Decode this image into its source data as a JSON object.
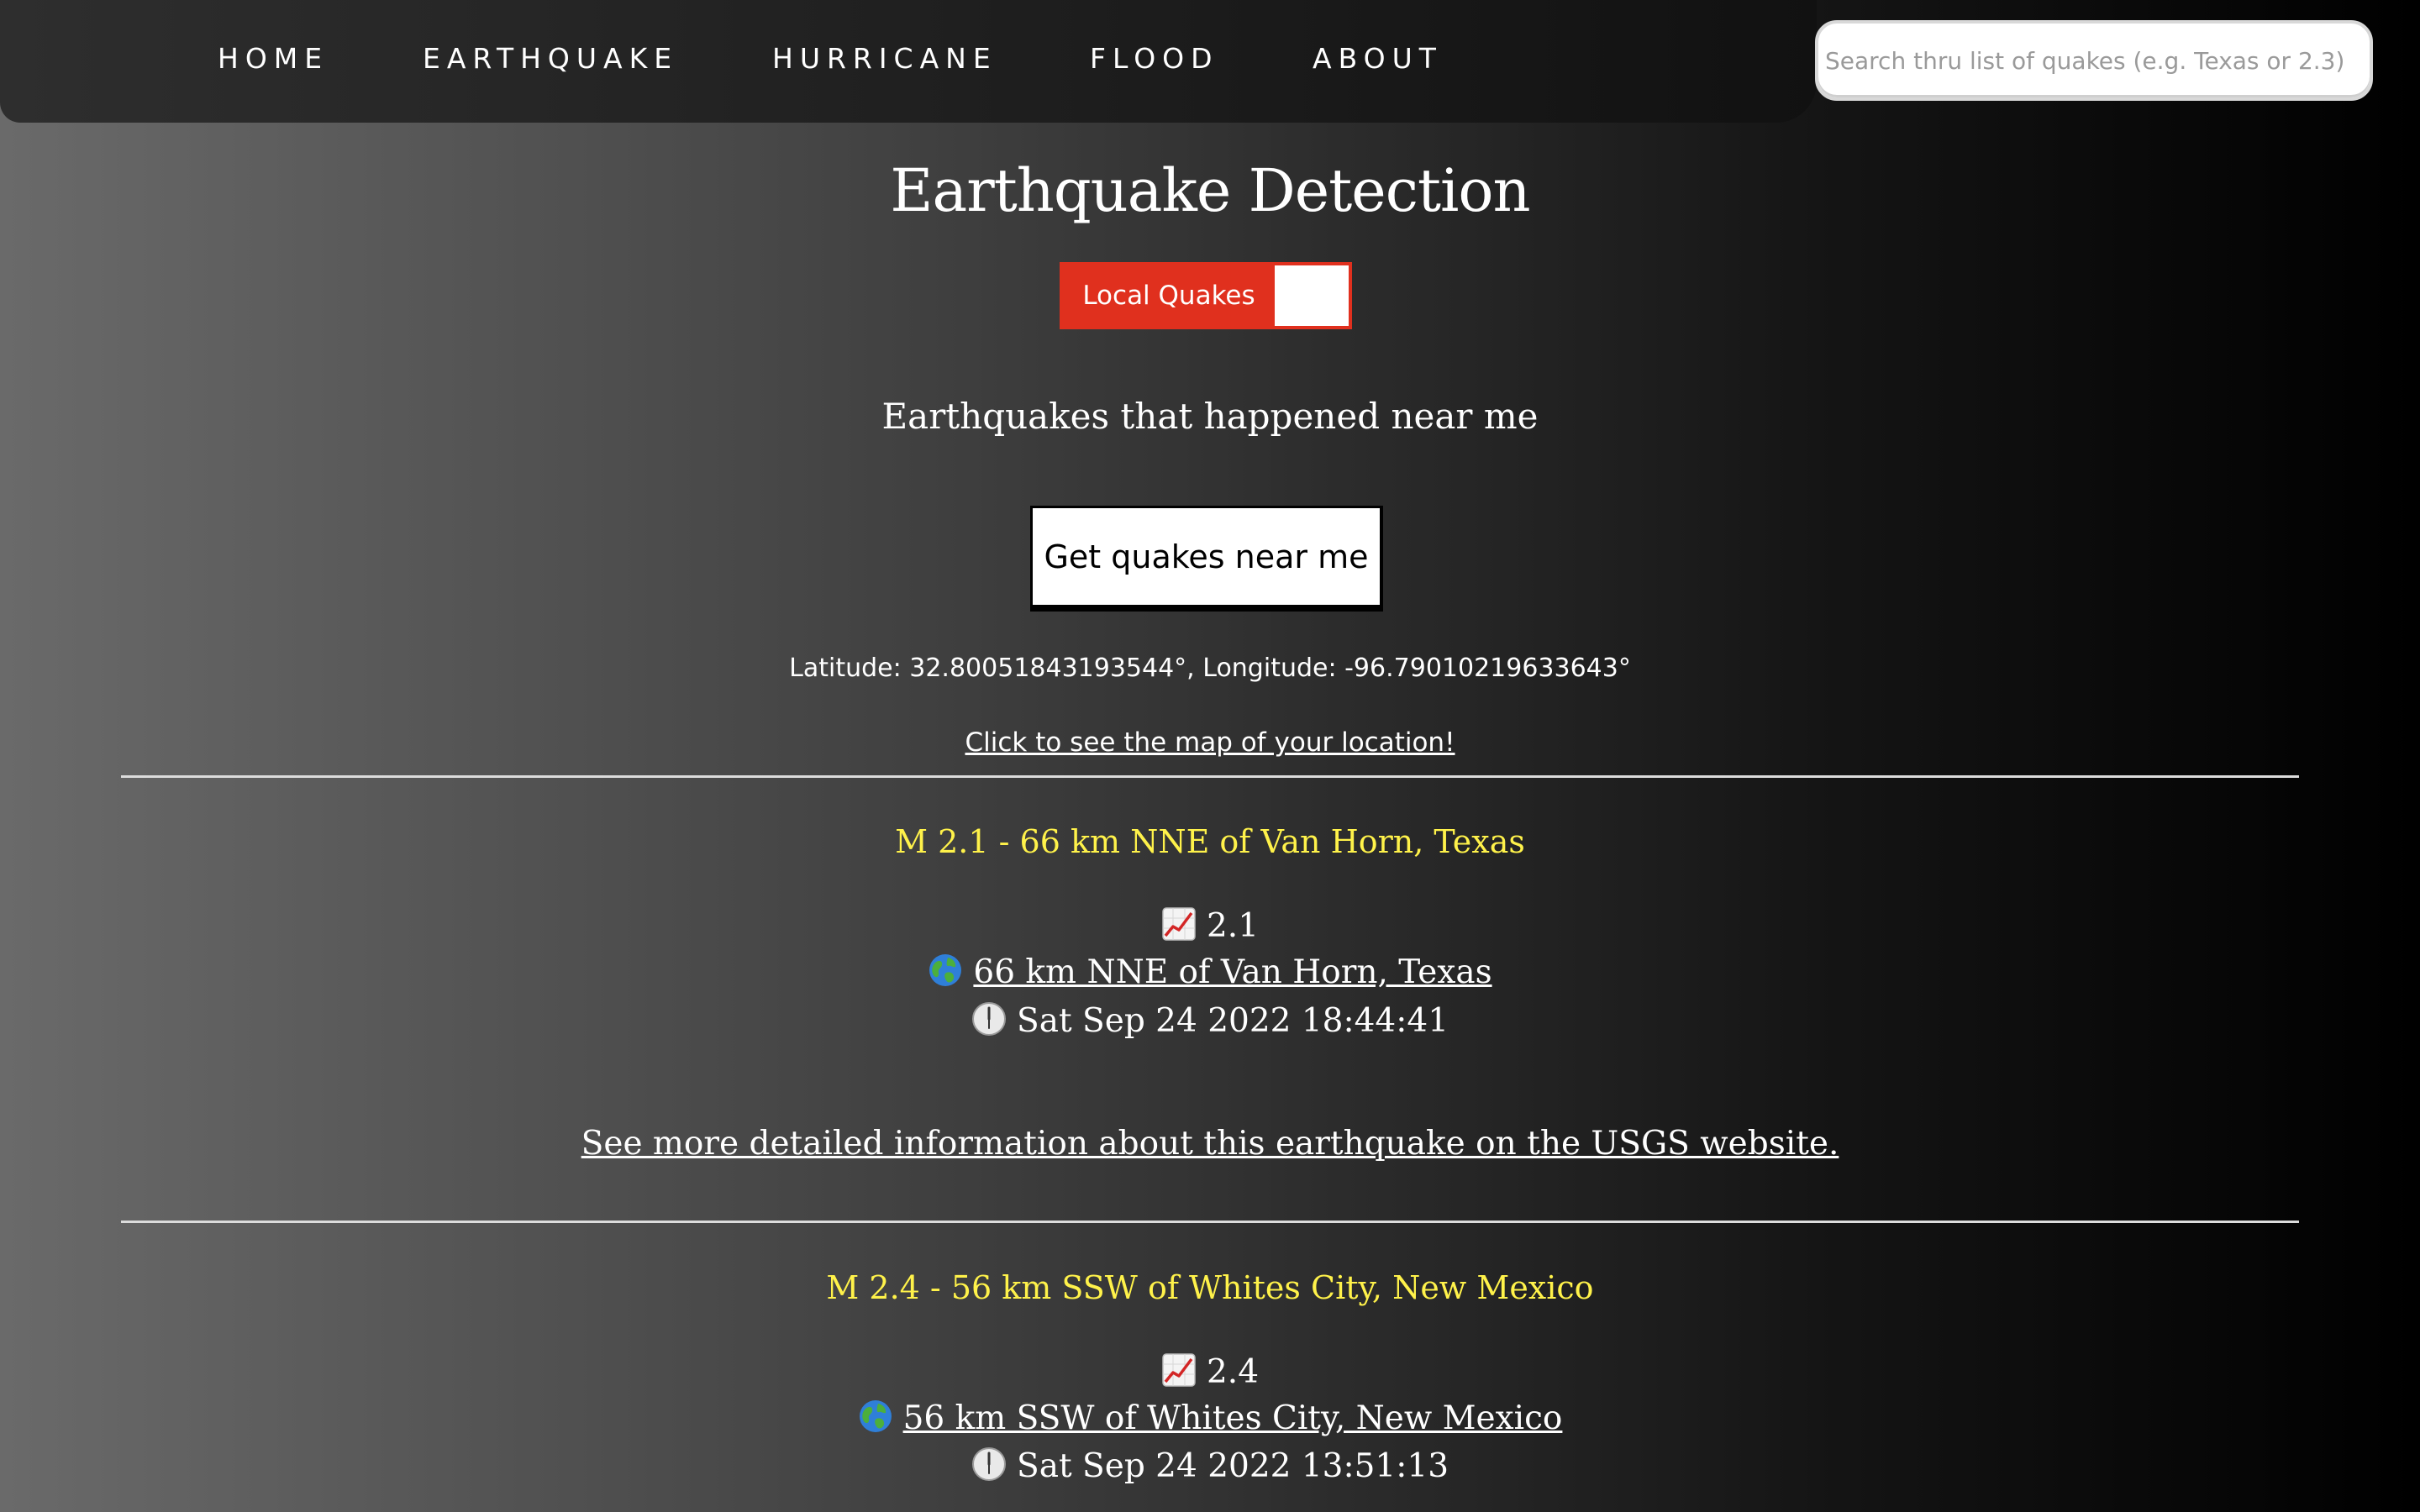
{
  "nav": {
    "items": [
      {
        "label": "HOME"
      },
      {
        "label": "EARTHQUAKE"
      },
      {
        "label": "HURRICANE"
      },
      {
        "label": "FLOOD"
      },
      {
        "label": "ABOUT"
      }
    ],
    "search_placeholder": "Search thru list of quakes (e.g. Texas or 2.3)"
  },
  "main": {
    "title": "Earthquake Detection",
    "toggle_label": "Local Quakes",
    "subtitle": "Earthquakes that happened near me",
    "get_button_label": "Get quakes near me",
    "coordinates": "Latitude: 32.80051843193544°, Longitude: -96.79010219633643°",
    "map_link": "Click to see the map of your location!"
  },
  "quakes": [
    {
      "title": "M 2.1 - 66 km NNE of Van Horn, Texas",
      "magnitude": "2.1",
      "place": "66 km NNE of Van Horn, Texas",
      "time": "Sat Sep 24 2022 18:44:41",
      "usgs_link": "See more detailed information about this earthquake on the USGS website."
    },
    {
      "title": "M 2.4 - 56 km SSW of Whites City, New Mexico",
      "magnitude": "2.4",
      "place": "56 km SSW of Whites City, New Mexico",
      "time": "Sat Sep 24 2022 13:51:13"
    }
  ],
  "icons": {
    "magnitude": "chart-increasing-icon",
    "place": "globe-icon",
    "time": "clock-icon"
  },
  "colors": {
    "accent_red": "#e0301e",
    "quake_title": "#fff24a"
  }
}
